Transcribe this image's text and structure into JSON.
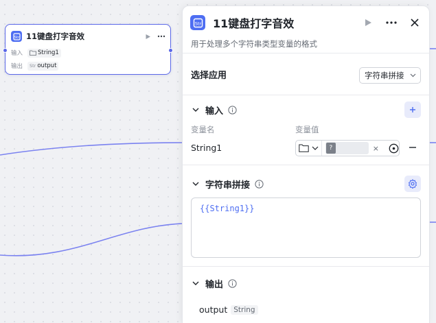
{
  "node": {
    "title": "11键盘打字音效",
    "input_label": "输入",
    "input_value": "String1",
    "output_label": "输出",
    "output_tag": "Str",
    "output_value": "output"
  },
  "panel": {
    "title": "11键盘打字音效",
    "description": "用于处理多个字符串类型变量的格式",
    "select_app_label": "选择应用",
    "select_app_value": "字符串拼接",
    "input_section": {
      "title": "输入",
      "col_name": "变量名",
      "col_value": "变量值",
      "variables": [
        {
          "name": "String1",
          "value_placeholder": "?"
        }
      ]
    },
    "concat_section": {
      "title": "字符串拼接",
      "template": "{{String1}}"
    },
    "output_section": {
      "title": "输出",
      "name": "output",
      "type": "String"
    }
  },
  "colors": {
    "accent": "#4e6ef2",
    "edge": "#7a82f0",
    "canvas": "#f0f1f4"
  }
}
